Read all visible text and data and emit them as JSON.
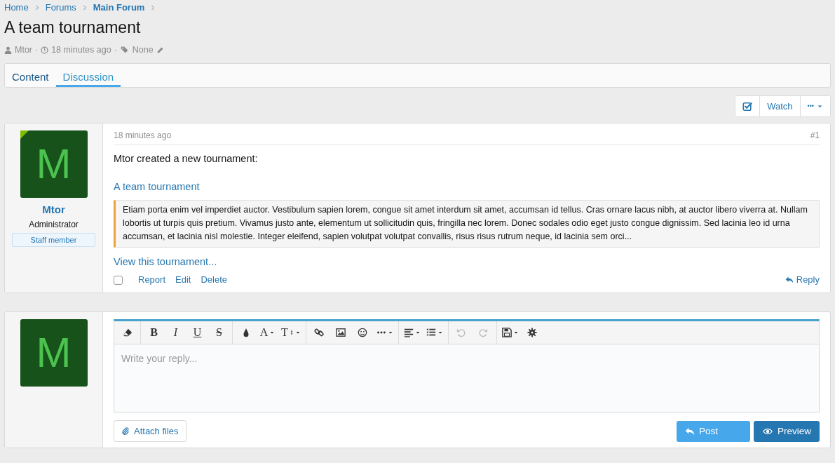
{
  "breadcrumb": [
    "Home",
    "Forums",
    "Main Forum"
  ],
  "title": "A team tournament",
  "meta": {
    "separator": "·",
    "author": "Mtor",
    "time": "18 minutes ago",
    "tags": "None"
  },
  "tabs": [
    {
      "label": "Content",
      "selected": false
    },
    {
      "label": "Discussion",
      "selected": true
    }
  ],
  "thread_actions": {
    "watch_checked": true,
    "watch": "Watch",
    "more": "•••"
  },
  "post": {
    "avatar_letter": "M",
    "online": true,
    "username": "Mtor",
    "user_title": "Administrator",
    "banner": "Staff member",
    "time": "18 minutes ago",
    "number": "#1",
    "intro": "Mtor created a new tournament:",
    "link": "A team tournament",
    "quote": "Etiam porta enim vel imperdiet auctor. Vestibulum sapien lorem, congue sit amet interdum sit amet, accumsan id tellus. Cras ornare lacus nibh, at auctor libero viverra at. Nullam lobortis ut turpis quis pretium. Vivamus justo ante, elementum ut sollicitudin quis, fringilla nec lorem. Donec sodales odio eget justo congue dignissim. Sed lacinia leo id urna accumsan, et lacinia nisl molestie. Integer eleifend, sapien volutpat volutpat convallis, risus risus rutrum neque, id lacinia sem orci...",
    "view_link": "View this tournament...",
    "selected": false,
    "actions": [
      "Report",
      "Edit",
      "Delete"
    ],
    "reply": "Reply"
  },
  "reply_form": {
    "avatar_letter": "M",
    "placeholder": "Write your reply...",
    "toolbar": [
      [
        {
          "kind": "eraser"
        }
      ],
      [
        {
          "kind": "bold",
          "label": "B"
        },
        {
          "kind": "italic",
          "label": "I"
        },
        {
          "kind": "underline",
          "label": "U"
        },
        {
          "kind": "strike",
          "label": "S"
        }
      ],
      [
        {
          "kind": "drop"
        },
        {
          "kind": "fontcolor",
          "label": "A",
          "dropdown": true
        },
        {
          "kind": "fontsize",
          "label": "T",
          "dropdown": true
        }
      ],
      [
        {
          "kind": "link"
        },
        {
          "kind": "image"
        },
        {
          "kind": "smiley"
        },
        {
          "kind": "more",
          "dropdown": true
        }
      ],
      [
        {
          "kind": "align",
          "dropdown": true
        },
        {
          "kind": "list",
          "dropdown": true
        }
      ],
      [
        {
          "kind": "undo",
          "disabled": true
        },
        {
          "kind": "redo",
          "disabled": true
        }
      ],
      [
        {
          "kind": "save",
          "dropdown": true
        },
        {
          "kind": "gear"
        }
      ]
    ],
    "attach": "Attach files",
    "post": "Post",
    "preview": "Preview"
  }
}
